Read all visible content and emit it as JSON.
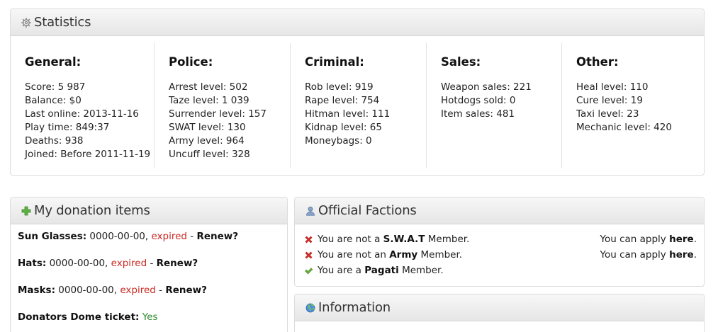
{
  "statistics": {
    "title": "Statistics",
    "icon": "gear-icon",
    "columns": [
      {
        "heading": "General:",
        "lines": [
          "Score: 5 987",
          "Balance: $0",
          "Last online: 2013-11-16",
          "Play time: 849:37",
          "Deaths: 938",
          "Joined: Before 2011-11-19"
        ]
      },
      {
        "heading": "Police:",
        "lines": [
          "Arrest level: 502",
          "Taze level: 1 039",
          "Surrender level: 157",
          "SWAT level: 130",
          "Army level: 964",
          "Uncuff level: 328"
        ]
      },
      {
        "heading": "Criminal:",
        "lines": [
          "Rob level: 919",
          "Rape level: 754",
          "Hitman level: 111",
          "Kidnap level: 65",
          "Moneybags: 0"
        ]
      },
      {
        "heading": "Sales:",
        "lines": [
          "Weapon sales: 221",
          "Hotdogs sold: 0",
          "Item sales: 481"
        ]
      },
      {
        "heading": "Other:",
        "lines": [
          "Heal level: 110",
          "Cure level: 19",
          "Taxi level: 23",
          "Mechanic level: 420"
        ]
      }
    ]
  },
  "donation": {
    "title": "My donation items",
    "icon": "plus-icon",
    "items": [
      {
        "name": "Sun Glasses:",
        "date": "0000-00-00,",
        "status": "expired",
        "sep": "-",
        "action": "Renew?"
      },
      {
        "name": "Hats:",
        "date": "0000-00-00,",
        "status": "expired",
        "sep": "-",
        "action": "Renew?"
      },
      {
        "name": "Masks:",
        "date": "0000-00-00,",
        "status": "expired",
        "sep": "-",
        "action": "Renew?"
      }
    ],
    "ticket": {
      "name": "Donators Dome ticket:",
      "value": "Yes"
    }
  },
  "factions": {
    "title": "Official Factions",
    "icon": "user-icon",
    "rows": [
      {
        "mark": "cross-icon",
        "pre": "You are not a",
        "faction": "S.W.A.T",
        "post": "Member.",
        "apply_pre": "You can apply",
        "apply_link": "here",
        "apply_post": "."
      },
      {
        "mark": "cross-icon",
        "pre": "You are not an",
        "faction": "Army",
        "post": "Member.",
        "apply_pre": "You can apply",
        "apply_link": "here",
        "apply_post": "."
      },
      {
        "mark": "check-icon",
        "pre": "You are a",
        "faction": "Pagati",
        "post": "Member."
      }
    ]
  },
  "information": {
    "title": "Information",
    "icon": "globe-icon"
  },
  "colors": {
    "expired": "#cc2a22",
    "yes": "#2e8b2e",
    "cross": "#d9302a",
    "check": "#5aa33a"
  }
}
